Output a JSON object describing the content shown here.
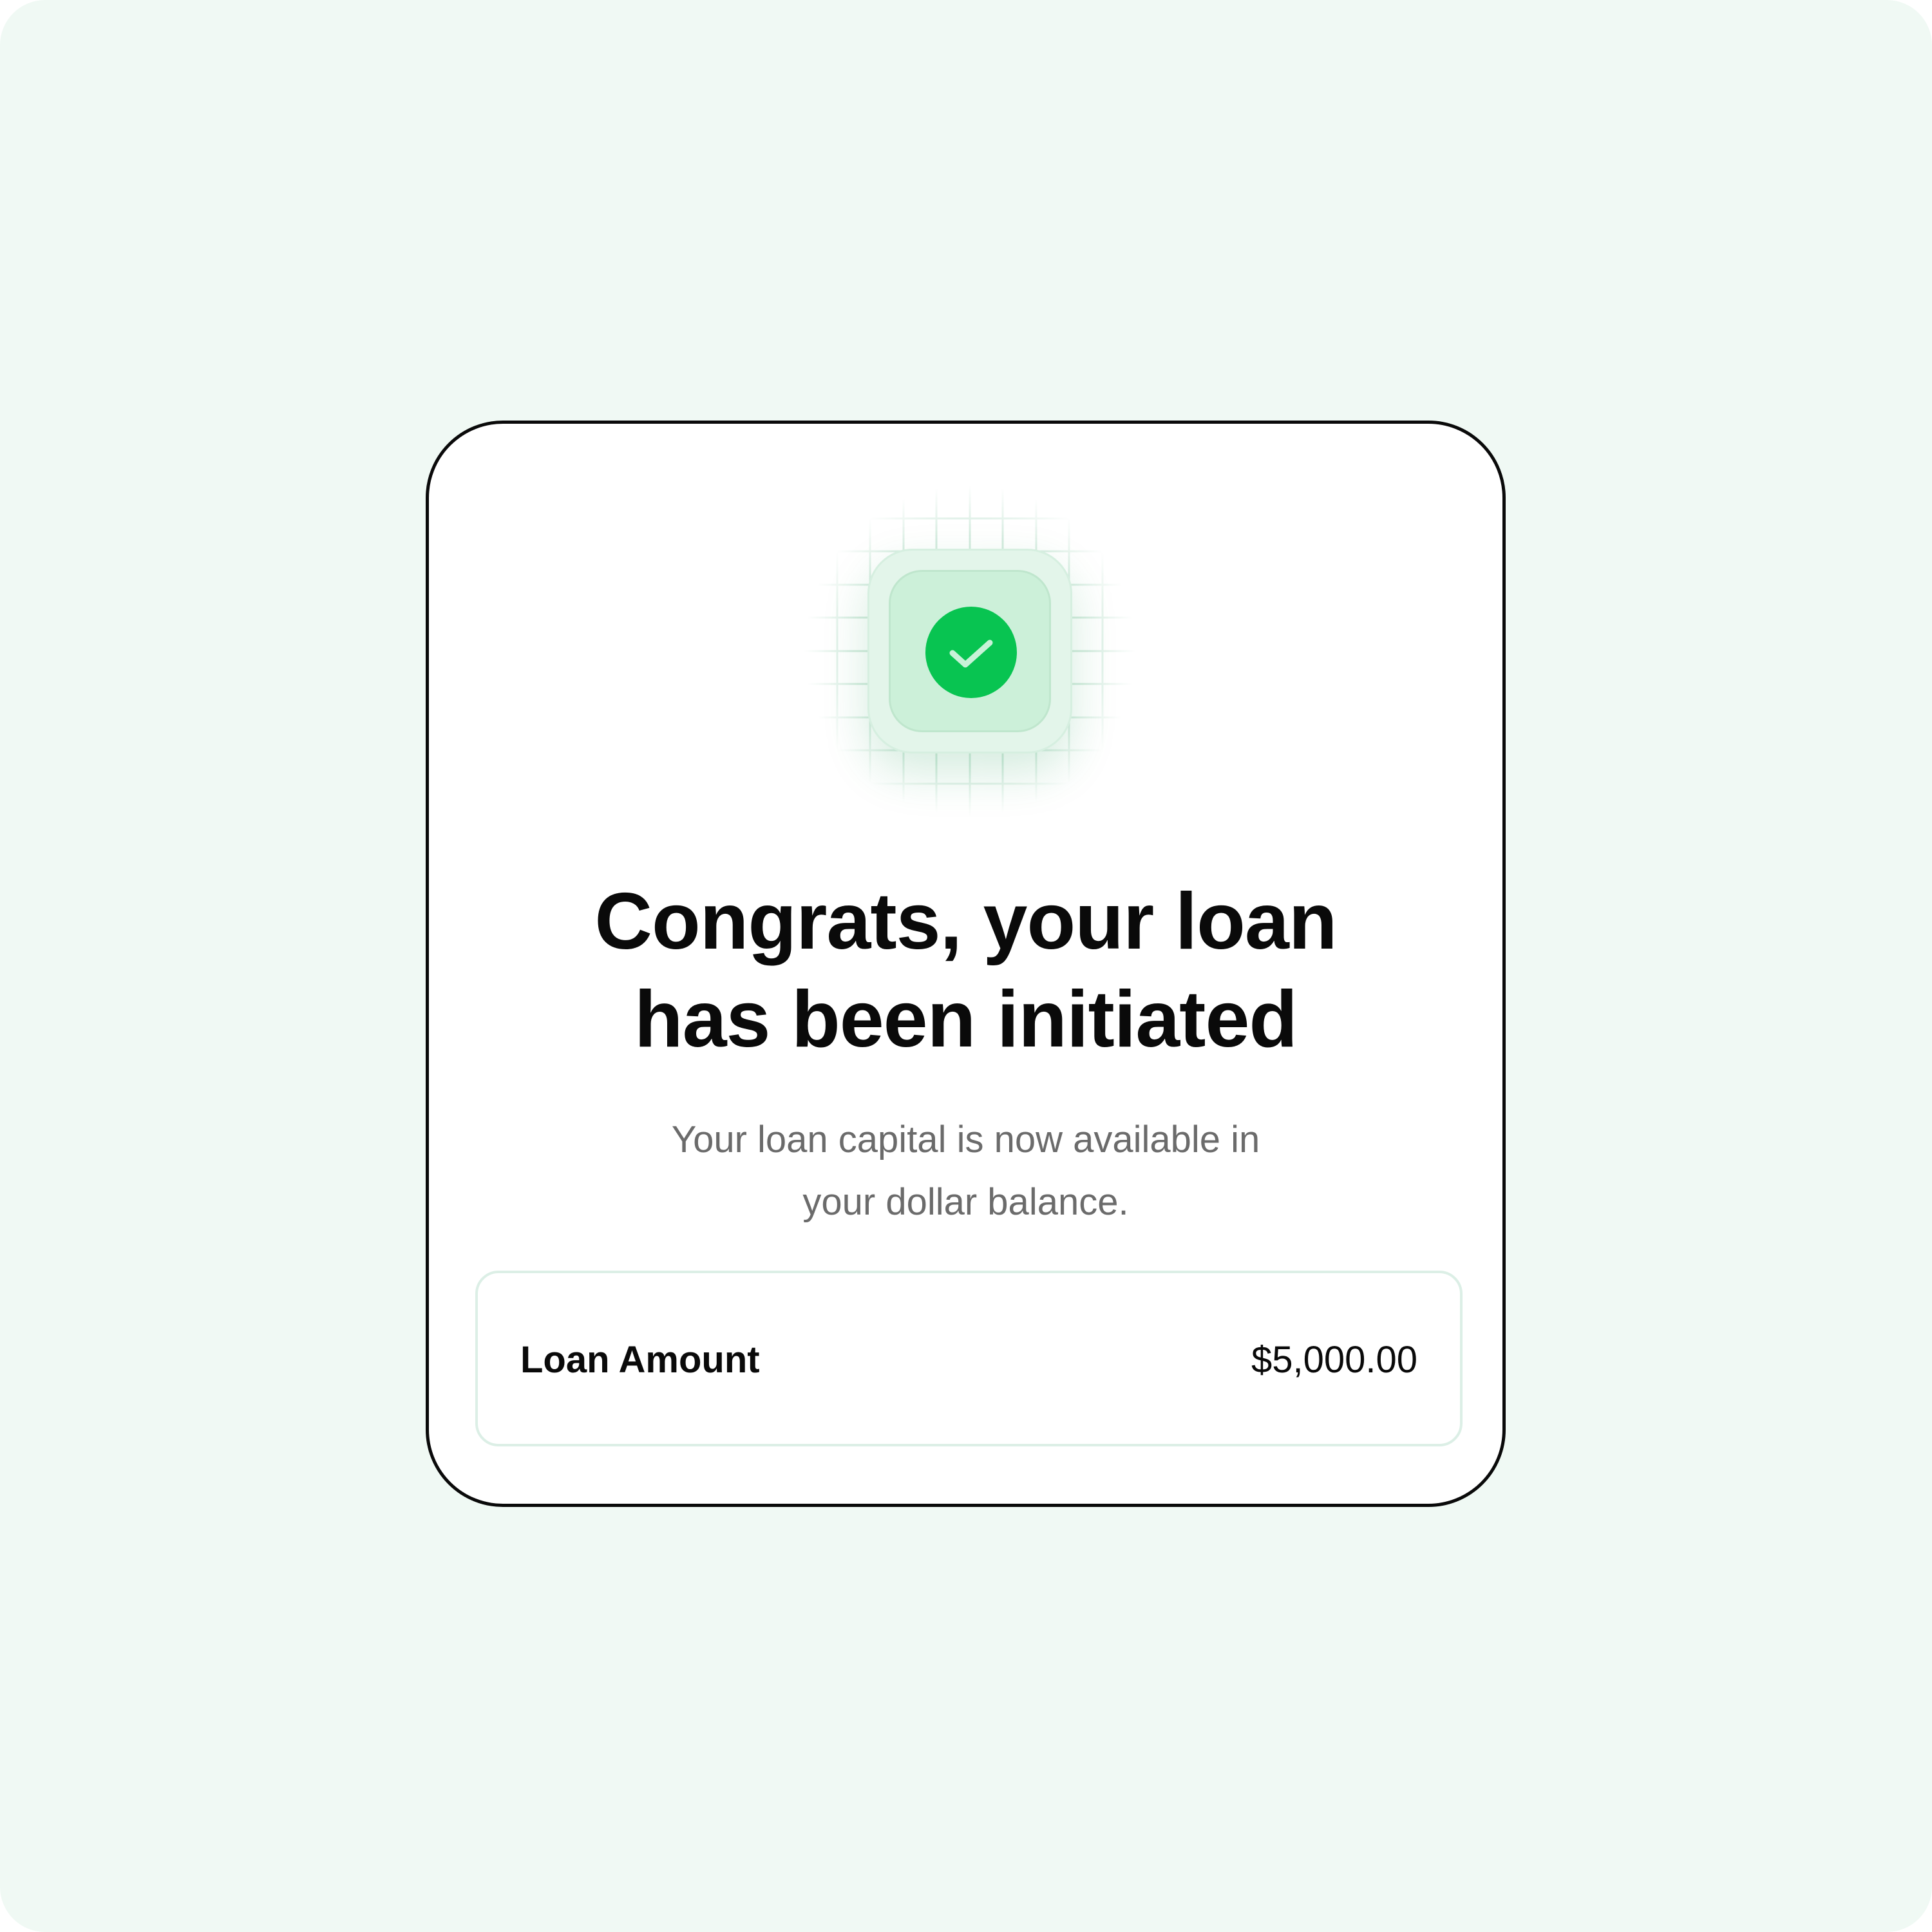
{
  "dialog": {
    "icon": "check-circle-icon",
    "headline_line1": "Congrats, your loan",
    "headline_line2": "has been initiated",
    "subtitle_line1": "Your loan capital is now available in",
    "subtitle_line2": "your dollar balance."
  },
  "loan_summary": {
    "label": "Loan Amount",
    "value": "$5,000.00"
  },
  "colors": {
    "page_background": "#f0f9f4",
    "accent_green": "#08c451",
    "card_border": "#0a0a0a",
    "subtitle_text": "#6b6b6b"
  }
}
